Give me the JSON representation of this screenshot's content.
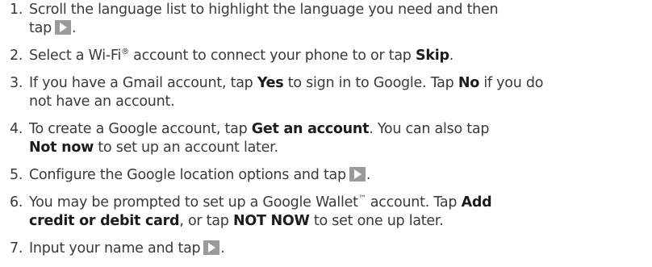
{
  "steps": [
    {
      "num": "1.",
      "line1": "Scroll the language list to highlight the language you need and then",
      "line2": "tap",
      "end": "."
    },
    {
      "num": "2.",
      "pre": "Select a Wi-Fi",
      "sup": "®",
      "mid": " account to connect your phone to or tap ",
      "bold": "Skip",
      "end": "."
    },
    {
      "num": "3.",
      "pre": "If you have a Gmail account, tap ",
      "bold1": "Yes",
      "mid": " to sign in to Google. Tap ",
      "bold2": "No",
      "post": " if you do",
      "line2": "not have an account."
    },
    {
      "num": "4.",
      "pre": "To create a Google account, tap ",
      "bold1": "Get an account",
      "post": ". You can also tap",
      "bold2": "Not now",
      "line2post": " to set up an account later."
    },
    {
      "num": "5.",
      "pre": "Configure the Google location options and tap",
      "end": "."
    },
    {
      "num": "6.",
      "pre": "You may be prompted to set up a Google Wallet",
      "sup": "™",
      "mid": " account. Tap ",
      "bold1": "Add",
      "bold1b": "credit or debit card",
      "mid2": ", or tap ",
      "bold2": "NOT NOW",
      "post": " to set one up later."
    },
    {
      "num": "7.",
      "pre": "Input your name and tap",
      "end": "."
    }
  ],
  "icons": {
    "next_button": "play-arrow-icon"
  }
}
